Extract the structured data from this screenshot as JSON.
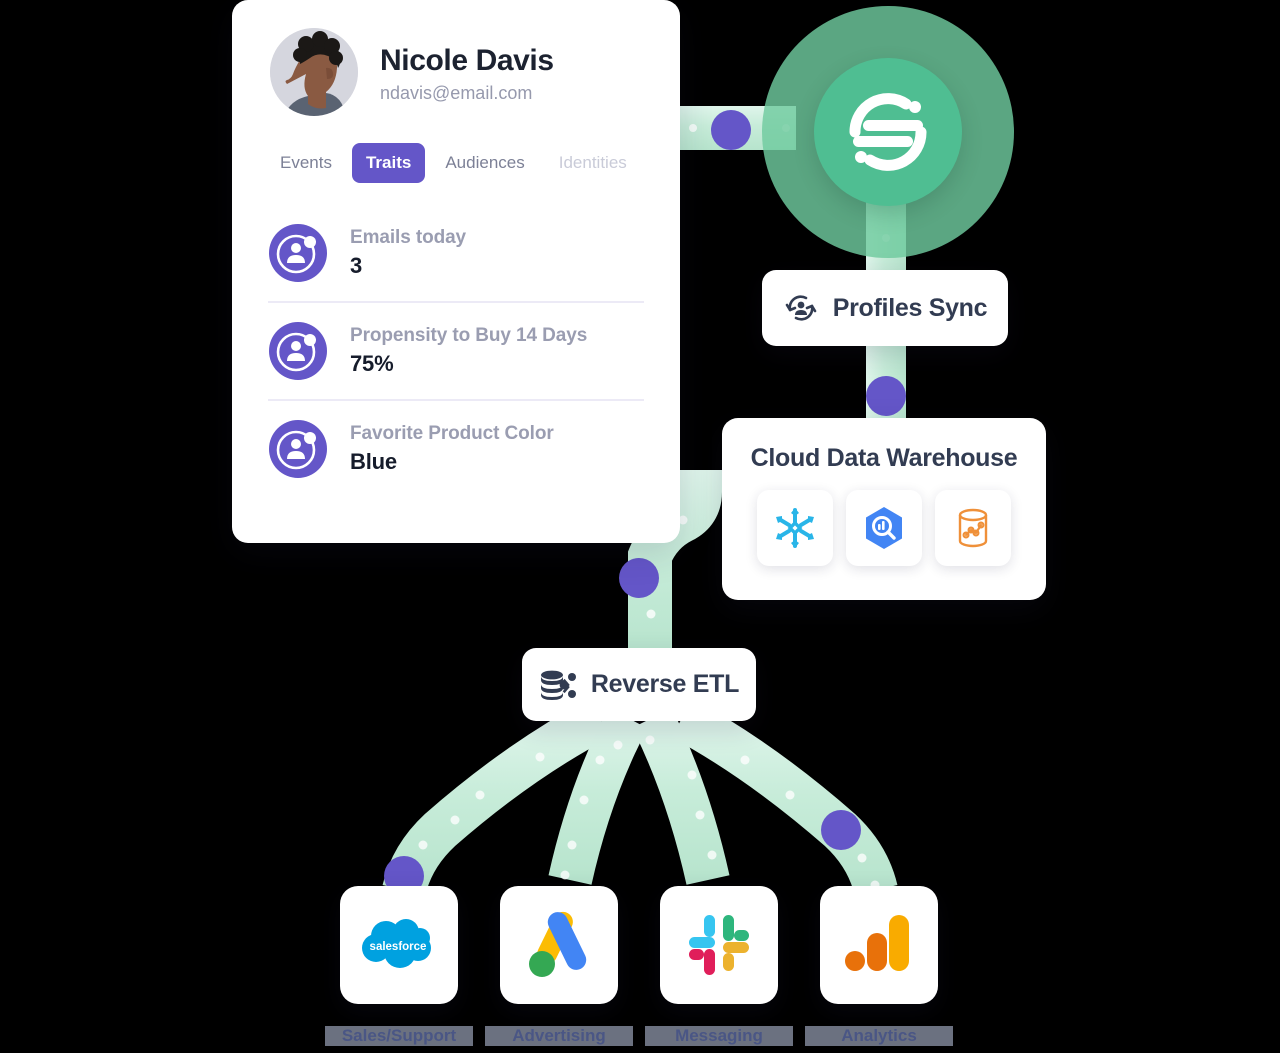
{
  "profile": {
    "name": "Nicole Davis",
    "email": "ndavis@email.com",
    "avatar_icon": "person-avatar-illustration",
    "tabs": [
      {
        "label": "Events",
        "active": false,
        "faded": false
      },
      {
        "label": "Traits",
        "active": true,
        "faded": false
      },
      {
        "label": "Audiences",
        "active": false,
        "faded": false
      },
      {
        "label": "Identities",
        "active": false,
        "faded": true
      }
    ],
    "traits": [
      {
        "icon": "profile-trait-icon",
        "label": "Emails today",
        "value": "3"
      },
      {
        "icon": "profile-trait-icon",
        "label": "Propensity to Buy 14 Days",
        "value": "75%"
      },
      {
        "icon": "profile-trait-icon",
        "label": "Favorite Product Color",
        "value": "Blue"
      }
    ]
  },
  "hub": {
    "logo_icon": "segment-logo-icon",
    "glow_color": "#6fca9f",
    "logo_color": "#4fbe92"
  },
  "profiles_sync": {
    "label": "Profiles Sync",
    "icon": "profiles-sync-icon"
  },
  "warehouse": {
    "title": "Cloud Data Warehouse",
    "tools": [
      {
        "name": "Snowflake",
        "icon": "snowflake-icon",
        "color": "#29b5e8"
      },
      {
        "name": "Google BigQuery",
        "icon": "bigquery-icon",
        "color": "#4285f4"
      },
      {
        "name": "Amazon Redshift",
        "icon": "redshift-icon",
        "color": "#ef9039"
      }
    ]
  },
  "reverse_etl": {
    "label": "Reverse ETL",
    "icon": "reverse-etl-icon"
  },
  "destinations": [
    {
      "label": "Sales/Support",
      "icon": "salesforce-icon",
      "color": "#00a1e0"
    },
    {
      "label": "Advertising",
      "icon": "google-ads-icon",
      "color": "#4285f4"
    },
    {
      "label": "Messaging",
      "icon": "slack-icon",
      "color": "#e01e5a"
    },
    {
      "label": "Analytics",
      "icon": "google-analytics-icon",
      "color": "#f9ab00"
    }
  ],
  "theme": {
    "pipe_color": "#c7ecd9",
    "pipe_highlight": "#ddf4e8",
    "node_purple": "#6456c8",
    "text_dark": "#323c52",
    "text_muted": "#9a9db1"
  }
}
